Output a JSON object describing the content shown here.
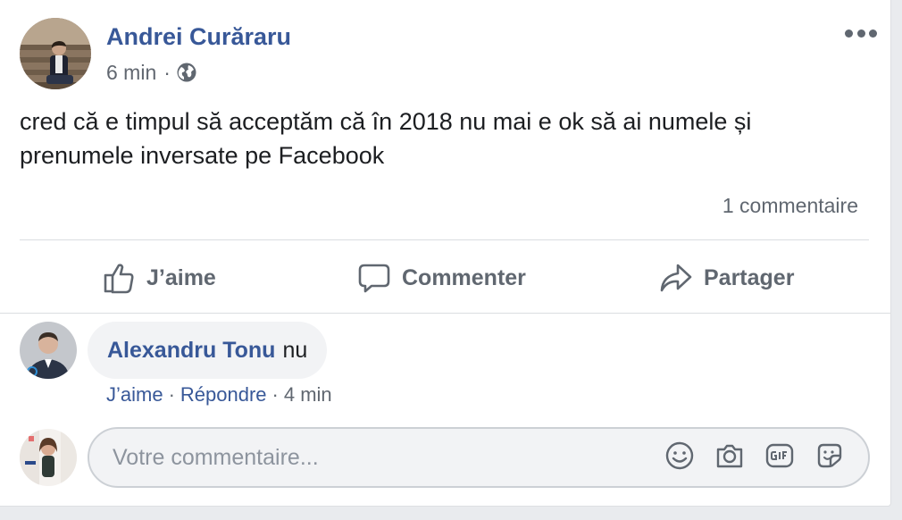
{
  "post": {
    "author_name": "Andrei Curăraru",
    "time": "6 min",
    "separator": "·",
    "privacy_icon": "globe-icon",
    "menu_icon": "more-options-icon",
    "text": "cred că e timpul să acceptăm că în 2018 nu mai e ok să ai numele și prenumele inversate pe Facebook",
    "comment_count": "1 commentaire"
  },
  "actions": {
    "like_label": "J’aime",
    "comment_label": "Commenter",
    "share_label": "Partager"
  },
  "comment": {
    "author": "Alexandru Tonu",
    "text": "nu",
    "like_label": "J’aime",
    "reply_label": "Répondre",
    "time": "4 min",
    "separator": "·"
  },
  "composer": {
    "placeholder": "Votre commentaire...",
    "tools": [
      "emoji-icon",
      "camera-icon",
      "gif-icon",
      "sticker-icon"
    ]
  },
  "colors": {
    "link": "#385898",
    "secondary_text": "#606770",
    "background": "#e9ebee"
  }
}
